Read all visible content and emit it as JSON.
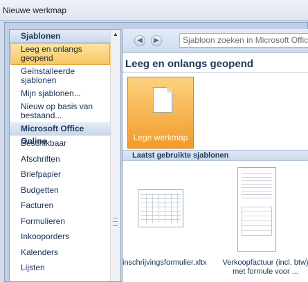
{
  "window": {
    "title": "Nieuwe werkmap"
  },
  "sidebar": {
    "header_templates": "Sjablonen",
    "items": [
      {
        "label": "Leeg en onlangs geopend",
        "selected": true
      },
      {
        "label": "Geïnstalleerde sjablonen"
      },
      {
        "label": "Mijn sjablonen..."
      },
      {
        "label": "Nieuw op basis van bestaand..."
      }
    ],
    "header_online": "Microsoft Office Online",
    "categories": [
      "Beschikbaar",
      "Afschriften",
      "Briefpapier",
      "Budgetten",
      "Facturen",
      "Formulieren",
      "Inkooporders",
      "Kalenders",
      "Lijsten"
    ]
  },
  "toolbar": {
    "search_placeholder": "Sjabloon zoeken in Microsoft Office"
  },
  "main": {
    "section_title": "Leeg en onlangs geopend",
    "blank_label": "Lege werkmap",
    "recent_header": "Laatst gebruikte sjablonen",
    "templates": [
      {
        "name": "inschrijvingsformulier.xltx"
      },
      {
        "name": "Verkoopfactuur (incl. btw) met formule voor ..."
      }
    ]
  },
  "colors": {
    "accent": "#f9c660",
    "header_text": "#1e395b"
  }
}
